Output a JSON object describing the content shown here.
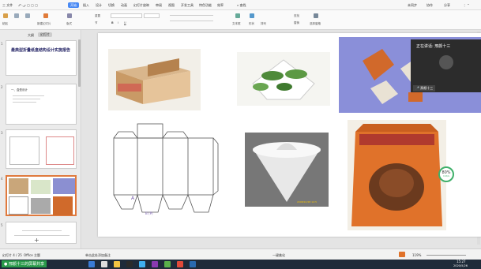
{
  "menubar": {
    "file": "三 文件",
    "tabs": [
      "开始",
      "插入",
      "设计",
      "切换",
      "动画",
      "幻灯片放映",
      "审阅",
      "视图",
      "开发工具",
      "特色功能",
      "效率"
    ],
    "active_tab": "开始",
    "search": "查找",
    "right": [
      "未同步",
      "协作",
      "分享"
    ]
  },
  "ribbon": {
    "labels": [
      "粘贴",
      "新建幻灯片",
      "版式",
      "重置",
      "节",
      "B",
      "I",
      "U",
      "文本框",
      "形状",
      "排列",
      "查找",
      "替换",
      "选择窗格"
    ]
  },
  "leftpanel": {
    "tabs": [
      "大纲",
      "幻灯片"
    ],
    "active_tab": "幻灯片",
    "slides": [
      {
        "num": "1",
        "title": "最典型折叠纸盒结构设计实施报告"
      },
      {
        "num": "2",
        "title": "一、盒型设计"
      },
      {
        "num": "3",
        "title": ""
      },
      {
        "num": "4",
        "title": ""
      },
      {
        "num": "5",
        "title": ""
      }
    ],
    "add": "+"
  },
  "slide": {
    "label_a": "A",
    "label_b": "B (P)",
    "date": "2008/10/28 14:5"
  },
  "badge": {
    "value": "80%",
    "sub": "0.2K/s"
  },
  "popup": {
    "title": "正在讲话: 邢颜十三",
    "name": "邢颜十三"
  },
  "statusbar": {
    "left": "幻灯片 4 / 25",
    "theme": "Office 主题",
    "notes": "单击此处添加备注",
    "center": "一键美化",
    "zoom": "119%"
  },
  "taskbar": {
    "share": "● 邢颜十三的屏幕共享",
    "time": "15:27",
    "date": "2020/5/26"
  },
  "colors": {
    "accent": "#4a8af4",
    "taskbar": "#1f2b3a"
  }
}
